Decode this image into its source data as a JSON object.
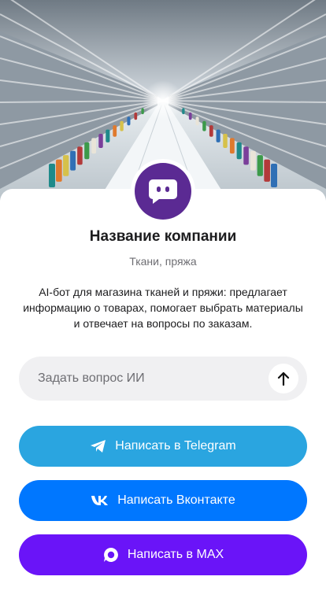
{
  "company": {
    "name": "Название компании",
    "category": "Ткани, пряжа",
    "description": "AI-бот для магазина тканей и пряжи: предлагает информацию о товарах, помогает выбрать материалы и отвечает на вопросы по заказам."
  },
  "ask": {
    "placeholder": "Задать вопрос ИИ",
    "value": ""
  },
  "buttons": {
    "telegram": {
      "label": "Написать в Telegram",
      "icon": "telegram-icon",
      "color": "#2AA5E0"
    },
    "vk": {
      "label": "Написать Вконтакте",
      "icon": "vk-icon",
      "color": "#0077FF"
    },
    "max": {
      "label": "Написать в MAX",
      "icon": "max-icon",
      "color": "#6A14F8"
    }
  },
  "avatar": {
    "icon": "chat-bot-icon",
    "color": "#5B2A93"
  }
}
